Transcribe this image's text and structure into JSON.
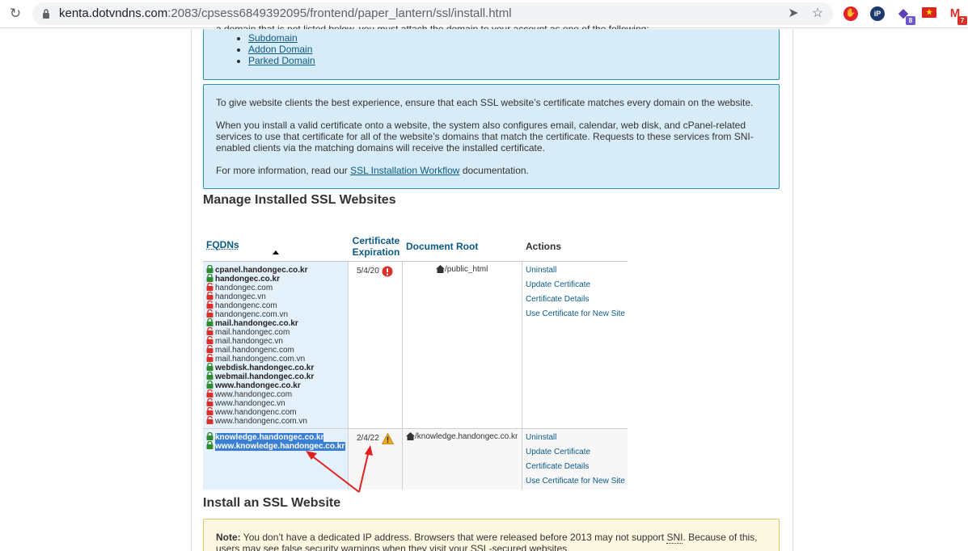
{
  "browser": {
    "url_host": "kenta.dotvndns.com",
    "url_path": ":2083/cpsess6849392095/frontend/paper_lantern/ssl/install.html",
    "extension_badge_1": "8",
    "extension_badge_2": "7"
  },
  "domain_types": {
    "partial_text": "a domain that is not listed below, you must attach the domain to your account as one of the following:",
    "items": [
      "Subdomain",
      "Addon Domain",
      "Parked Domain"
    ]
  },
  "sni_info": {
    "para1": "To give website clients the best experience, ensure that each SSL website’s certificate matches every domain on the website.",
    "para2": "When you install a valid certificate onto a website, the system also configures email, calendar, web disk, and cPanel-related services to use that certificate for all of the website’s domains that match the certificate. Requests to these services from SNI-enabled clients via the matching domains will receive the installed certificate.",
    "para3_pre": "For more information, read our ",
    "para3_link": "SSL Installation Workflow",
    "para3_post": " documentation."
  },
  "manage": {
    "title": "Manage Installed SSL Websites",
    "headers": {
      "fqdns": "FQDNs",
      "cert_line1": "Certificate",
      "cert_line2": "Expiration",
      "docroot": "Document Root",
      "actions": "Actions"
    },
    "rows": [
      {
        "fqdns": [
          {
            "name": "cpanel.handongec.co.kr",
            "secure": true
          },
          {
            "name": "handongec.co.kr",
            "secure": true
          },
          {
            "name": "handongec.com",
            "secure": false
          },
          {
            "name": "handongec.vn",
            "secure": false
          },
          {
            "name": "handongenc.com",
            "secure": false
          },
          {
            "name": "handongenc.com.vn",
            "secure": false
          },
          {
            "name": "mail.handongec.co.kr",
            "secure": true
          },
          {
            "name": "mail.handongec.com",
            "secure": false
          },
          {
            "name": "mail.handongec.vn",
            "secure": false
          },
          {
            "name": "mail.handongenc.com",
            "secure": false
          },
          {
            "name": "mail.handongenc.com.vn",
            "secure": false
          },
          {
            "name": "webdisk.handongec.co.kr",
            "secure": true
          },
          {
            "name": "webmail.handongec.co.kr",
            "secure": true
          },
          {
            "name": "www.handongec.co.kr",
            "secure": true
          },
          {
            "name": "www.handongec.com",
            "secure": false
          },
          {
            "name": "www.handongec.vn",
            "secure": false
          },
          {
            "name": "www.handongenc.com",
            "secure": false
          },
          {
            "name": "www.handongenc.com.vn",
            "secure": false
          }
        ],
        "expiration": "5/4/20",
        "docroot": "/public_html"
      },
      {
        "fqdns": [
          {
            "name": "knowledge.handongec.co.kr",
            "secure": true
          },
          {
            "name": "www.knowledge.handongec.co.kr",
            "secure": true
          }
        ],
        "expiration": "2/4/22",
        "docroot": "/knowledge.handongec.co.kr"
      }
    ],
    "actions": [
      "Uninstall",
      "Update Certificate",
      "Certificate Details",
      "Use Certificate for New Site"
    ]
  },
  "install": {
    "title": "Install an SSL Website",
    "note_label": "Note:",
    "note_pre": " You don’t have a dedicated IP address. Browsers that were released before 2013 may not support ",
    "note_abbr": "SNI",
    "note_post": ". Because of this, users may see false security warnings when they visit your SSL-secured websites."
  },
  "colors": {
    "info_bg": "#d8ecf7",
    "info_border": "#2f8fb4",
    "link": "#0b5a85",
    "secure_lock": "#2e8b2e",
    "insecure_lock": "#d9302c",
    "annotation_arrow": "#e02020"
  }
}
